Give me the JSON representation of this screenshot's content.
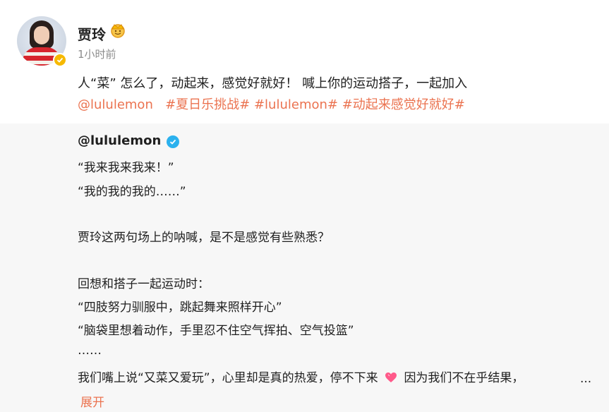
{
  "post": {
    "author": "贾玲",
    "time": "1小时前",
    "text_plain": "人“菜” 怎么了，动起来，感觉好就好！ 喊上你的运动搭子，一起加入",
    "mention": "@lululemon",
    "hashtags": [
      "#夏日乐挑战#",
      "#lululemon#",
      "#动起来感觉好就好#"
    ]
  },
  "repost": {
    "author": "@lululemon",
    "lines": [
      "“我来我来我来！”",
      "“我的我的我的……”",
      "贾玲这两句场上的呐喊，是不是感觉有些熟悉？",
      "回想和搭子一起运动时：",
      "“四肢努力驯服中，跳起舞来照样开心”",
      "“脑袋里想着动作，手里忍不住空气挥拍、空气投篮”",
      "……"
    ],
    "last_line_before": "我们嘴上说“又菜又爱玩”，心里却是真的热爱，停不下来",
    "last_line_after": "因为我们不在乎结果，",
    "ellipsis": "...",
    "expand_label": "展开"
  },
  "colors": {
    "link": "#eb7350",
    "quote_bg": "#f7f7f7",
    "verified_blue": "#2bb1ee",
    "verified_gold": "#f6b900"
  },
  "icons": [
    "avatar",
    "gold-verified-icon",
    "crown-badge-icon",
    "blue-verified-icon",
    "heart-emoji-icon"
  ]
}
